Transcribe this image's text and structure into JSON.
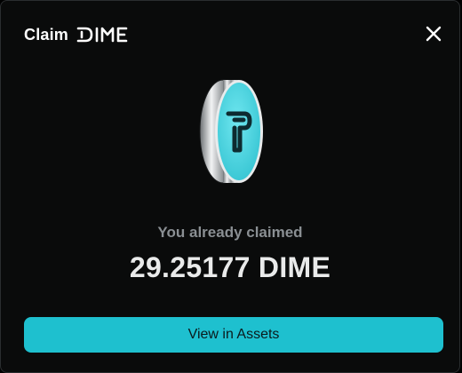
{
  "header": {
    "title": "Claim",
    "logo_text": "DIME",
    "logo_icon": "dime-logo-icon",
    "close_icon": "close-icon"
  },
  "coin": {
    "icon": "dime-coin-icon",
    "colors": {
      "face": "#4fd8e4",
      "rim": "#c9ccce",
      "glyph": "#0d2b30"
    }
  },
  "status": {
    "message": "You already claimed",
    "amount": "29.25177 DIME"
  },
  "actions": {
    "view_assets_label": "View in Assets"
  },
  "colors": {
    "background": "#0a0b0b",
    "accent": "#1ec0cf",
    "text_primary": "#e9eaea",
    "text_muted": "#8a8f93"
  }
}
